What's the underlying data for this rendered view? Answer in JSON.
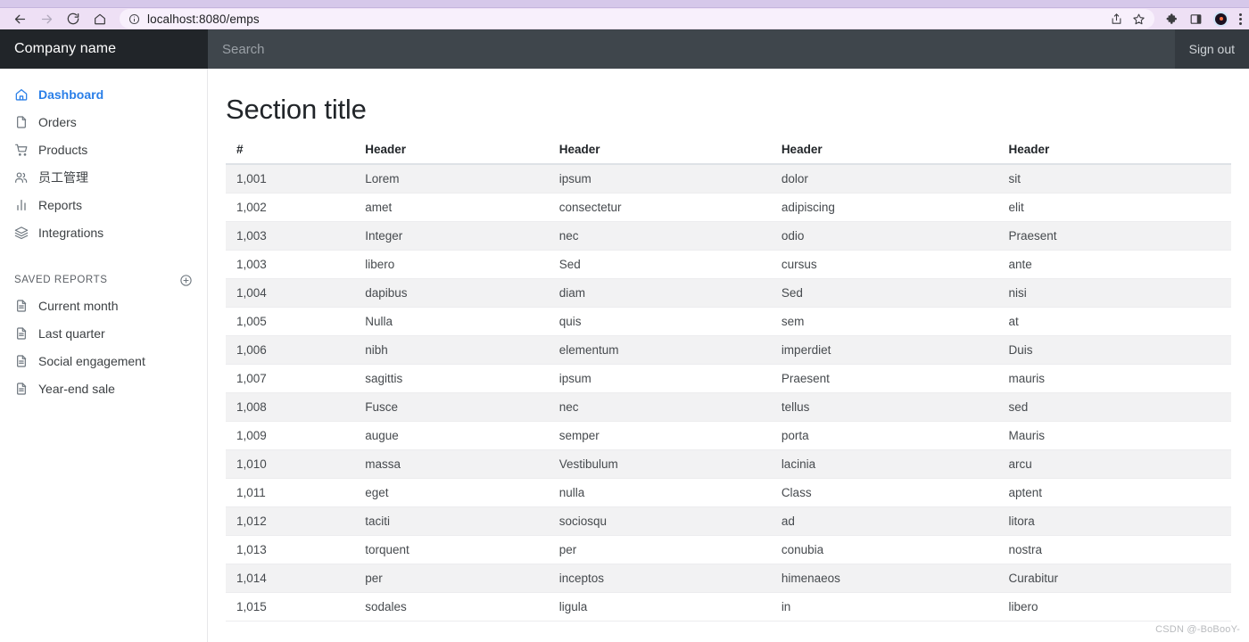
{
  "browser": {
    "back_icon": "back-arrow-icon",
    "forward_icon": "forward-arrow-icon",
    "reload_icon": "reload-icon",
    "home_icon": "home-icon",
    "site_info_icon": "site-info-icon",
    "url": "localhost:8080/emps",
    "share_icon": "share-icon",
    "bookmark_icon": "star-icon",
    "extensions_icon": "puzzle-piece-icon",
    "sidepanel_icon": "side-panel-icon",
    "profile_icon": "profile-avatar-icon",
    "menu_icon": "three-dot-menu-icon"
  },
  "navbar": {
    "brand": "Company name",
    "search_placeholder": "Search",
    "search_value": "",
    "signout_label": "Sign out"
  },
  "sidebar": {
    "items": [
      {
        "label": "Dashboard",
        "icon": "home-icon",
        "active": true
      },
      {
        "label": "Orders",
        "icon": "file-icon",
        "active": false
      },
      {
        "label": "Products",
        "icon": "cart-icon",
        "active": false
      },
      {
        "label": "员工管理",
        "icon": "users-icon",
        "active": false
      },
      {
        "label": "Reports",
        "icon": "bar-chart-icon",
        "active": false
      },
      {
        "label": "Integrations",
        "icon": "layers-icon",
        "active": false
      }
    ],
    "saved_reports_title": "Saved reports",
    "add_icon": "plus-circle-icon",
    "saved_reports": [
      {
        "label": "Current month",
        "icon": "file-icon"
      },
      {
        "label": "Last quarter",
        "icon": "file-icon"
      },
      {
        "label": "Social engagement",
        "icon": "file-icon"
      },
      {
        "label": "Year-end sale",
        "icon": "file-icon"
      }
    ]
  },
  "main": {
    "title": "Section title",
    "table": {
      "headers": [
        "#",
        "Header",
        "Header",
        "Header",
        "Header"
      ],
      "rows": [
        [
          "1,001",
          "Lorem",
          "ipsum",
          "dolor",
          "sit"
        ],
        [
          "1,002",
          "amet",
          "consectetur",
          "adipiscing",
          "elit"
        ],
        [
          "1,003",
          "Integer",
          "nec",
          "odio",
          "Praesent"
        ],
        [
          "1,003",
          "libero",
          "Sed",
          "cursus",
          "ante"
        ],
        [
          "1,004",
          "dapibus",
          "diam",
          "Sed",
          "nisi"
        ],
        [
          "1,005",
          "Nulla",
          "quis",
          "sem",
          "at"
        ],
        [
          "1,006",
          "nibh",
          "elementum",
          "imperdiet",
          "Duis"
        ],
        [
          "1,007",
          "sagittis",
          "ipsum",
          "Praesent",
          "mauris"
        ],
        [
          "1,008",
          "Fusce",
          "nec",
          "tellus",
          "sed"
        ],
        [
          "1,009",
          "augue",
          "semper",
          "porta",
          "Mauris"
        ],
        [
          "1,010",
          "massa",
          "Vestibulum",
          "lacinia",
          "arcu"
        ],
        [
          "1,011",
          "eget",
          "nulla",
          "Class",
          "aptent"
        ],
        [
          "1,012",
          "taciti",
          "sociosqu",
          "ad",
          "litora"
        ],
        [
          "1,013",
          "torquent",
          "per",
          "conubia",
          "nostra"
        ],
        [
          "1,014",
          "per",
          "inceptos",
          "himenaeos",
          "Curabitur"
        ],
        [
          "1,015",
          "sodales",
          "ligula",
          "in",
          "libero"
        ]
      ]
    },
    "watermark": "CSDN @-BoBooY-"
  },
  "colors": {
    "accent": "#2a7fe8",
    "navbar_bg": "#343a40",
    "brand_bg": "#212529",
    "chrome_bg": "#eee0f5",
    "row_stripe": "#f2f2f3"
  }
}
